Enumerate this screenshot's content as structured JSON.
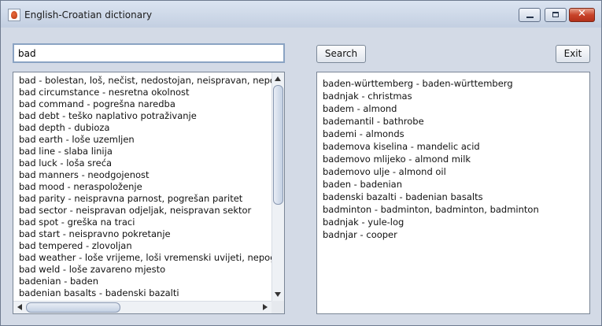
{
  "window": {
    "title": "English-Croatian dictionary",
    "icon": "java-cup-icon",
    "controls": [
      "minimize",
      "maximize",
      "close"
    ]
  },
  "search": {
    "value": "bad",
    "button_label": "Search"
  },
  "exit_button_label": "Exit",
  "suggestions": [
    "bad - bolestan, loš, nečist, nedostojan, neispravan, nepogodan",
    "bad circumstance - nesretna okolnost",
    "bad command - pogrešna naredba",
    "bad debt - teško naplativo potraživanje",
    "bad depth - dubioza",
    "bad earth - loše uzemljen",
    "bad line - slaba linija",
    "bad luck - loša sreća",
    "bad manners - neodgojenost",
    "bad mood - neraspoloženje",
    "bad parity - neispravna parnost, pogrešan paritet",
    "bad sector - neispravan odjeljak, neispravan sektor",
    "bad spot - greška na traci",
    "bad start - neispravno pokretanje",
    "bad tempered - zlovoljan",
    "bad weather - loše vrijeme, loši vremenski uvijeti, nepogoda",
    "bad weld - loše zavareno mjesto",
    "badenian - baden",
    "badenian basalts - badenski bazalti"
  ],
  "results": [
    "baden-württemberg - baden-württemberg",
    "badnjak - christmas",
    "badem - almond",
    "bademantil - bathrobe",
    "bademi - almonds",
    "bademova kiselina - mandelic acid",
    "bademovo mlijeko - almond milk",
    "bademovo ulje - almond oil",
    "baden - badenian",
    "badenski bazalti - badenian basalts",
    "badminton - badminton, badminton, badminton",
    "badnjak - yule-log",
    "badnjar - cooper"
  ],
  "colors": {
    "window_bg": "#d3dae6",
    "close_button": "#c8432a",
    "input_border": "#8aa3c3"
  }
}
